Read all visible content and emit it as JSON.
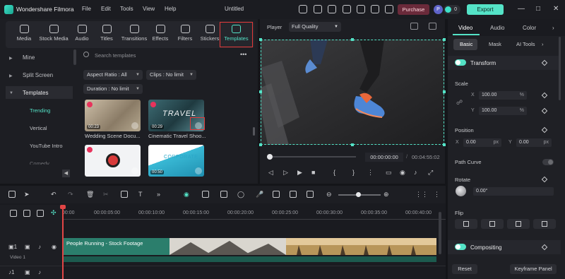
{
  "app": {
    "name": "Wondershare Filmora",
    "project_title": "Untitled"
  },
  "menu": [
    "File",
    "Edit",
    "Tools",
    "View",
    "Help"
  ],
  "titlebar": {
    "purchase_label": "Purchase",
    "avatar_letter": "P",
    "credits": "0",
    "export_label": "Export",
    "icons": [
      "send-icon",
      "save-icon",
      "monitor-icon",
      "cloud-icon",
      "headset-icon",
      "grid-icon",
      "download-icon"
    ]
  },
  "media_tabs": [
    {
      "label": "Media",
      "icon": "media-icon"
    },
    {
      "label": "Stock Media",
      "icon": "stock-media-icon"
    },
    {
      "label": "Audio",
      "icon": "audio-icon"
    },
    {
      "label": "Titles",
      "icon": "titles-icon"
    },
    {
      "label": "Transitions",
      "icon": "transitions-icon"
    },
    {
      "label": "Effects",
      "icon": "effects-icon"
    },
    {
      "label": "Filters",
      "icon": "filters-icon"
    },
    {
      "label": "Stickers",
      "icon": "stickers-icon"
    },
    {
      "label": "Templates",
      "icon": "templates-icon",
      "active": true
    }
  ],
  "sidebar": {
    "items": [
      "Mine",
      "Split Screen",
      "Templates"
    ],
    "sub_items": [
      "Trending",
      "Vertical",
      "YouTube Intro",
      "Comedy"
    ],
    "active_sub": "Trending"
  },
  "search": {
    "placeholder": "Search templates"
  },
  "filters": {
    "aspect_ratio": "Aspect Ratio : All",
    "clips": "Clips : No limit",
    "duration": "Duration : No limit"
  },
  "templates": [
    {
      "title": "Wedding Scene Docu...",
      "duration": "00:23"
    },
    {
      "title": "Cinematic Travel Shoo...",
      "duration": "00:29",
      "overlay_text": "TRAVEL"
    },
    {
      "title": "",
      "duration": ""
    },
    {
      "title": "",
      "duration": "00:50",
      "overlay_text": "CORPORATE"
    }
  ],
  "player": {
    "label": "Player",
    "quality": "Full Quality",
    "current_time": "00:00:00:00",
    "separator": "/",
    "total_time": "00:04:55:02"
  },
  "right_panel": {
    "tabs": [
      "Video",
      "Audio",
      "Color"
    ],
    "active_tab": "Video",
    "sub_tabs": [
      "Basic",
      "Mask",
      "AI Tools"
    ],
    "transform_label": "Transform",
    "scale_label": "Scale",
    "scale_x": "100.00",
    "scale_y": "100.00",
    "scale_unit": "%",
    "position_label": "Position",
    "pos_x": "0.00",
    "pos_y": "0.00",
    "pos_unit": "px",
    "path_curve_label": "Path Curve",
    "rotate_label": "Rotate",
    "rotate_value": "0.00°",
    "flip_label": "Flip",
    "compositing_label": "Compositing",
    "reset_label": "Reset",
    "keyframe_label": "Keyframe Panel",
    "x_label": "X",
    "y_label": "Y"
  },
  "timeline": {
    "ticks": [
      "00:00",
      "00:00:05:00",
      "00:00:10:00",
      "00:00:15:00",
      "00:00:20:00",
      "00:00:25:00",
      "00:00:30:00",
      "00:00:35:00",
      "00:00:40:00"
    ],
    "clip_label": "People Running - Stock Footage",
    "track_name": "Video 1",
    "track_number": "1",
    "audio_track_number": "1"
  },
  "colors": {
    "accent": "#54e3c7",
    "highlight": "#e23a3a",
    "clip": "#2b7e6c"
  }
}
